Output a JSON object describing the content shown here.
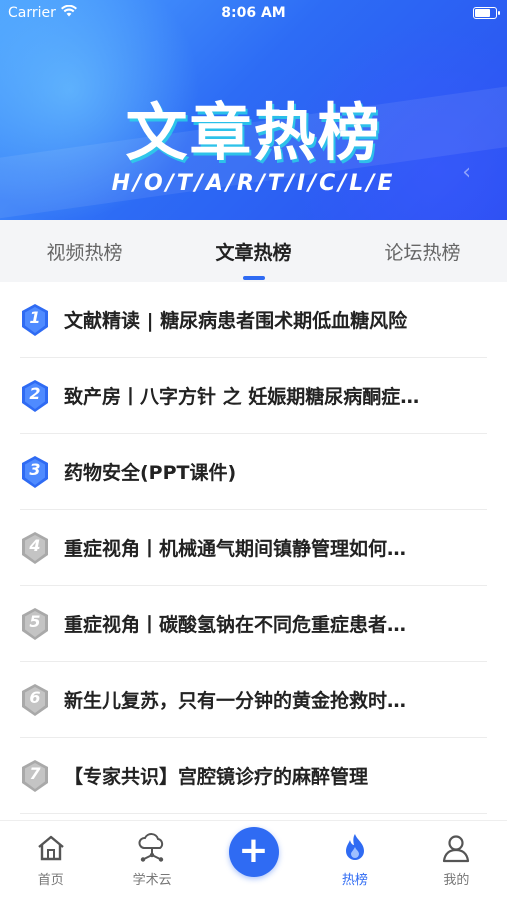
{
  "status": {
    "carrier": "Carrier",
    "time": "8:06 AM",
    "battery": 0.85
  },
  "hero": {
    "title": "文章热榜",
    "subtitle": "H/O/T/A/R/T/I/C/L/E"
  },
  "tabs": [
    {
      "label": "视频热榜",
      "active": false
    },
    {
      "label": "文章热榜",
      "active": true
    },
    {
      "label": "论坛热榜",
      "active": false
    }
  ],
  "articles": [
    {
      "rank": "1",
      "title": "文献精读 | 糖尿病患者围术期低血糖风险",
      "tier": "top"
    },
    {
      "rank": "2",
      "title": "致产房丨八字方针 之 妊娠期糖尿病酮症…",
      "tier": "top"
    },
    {
      "rank": "3",
      "title": "药物安全(PPT课件)",
      "tier": "top"
    },
    {
      "rank": "4",
      "title": "重症视角丨机械通气期间镇静管理如何…",
      "tier": "normal"
    },
    {
      "rank": "5",
      "title": "重症视角丨碳酸氢钠在不同危重症患者…",
      "tier": "normal"
    },
    {
      "rank": "6",
      "title": "新生儿复苏，只有一分钟的黄金抢救时…",
      "tier": "normal"
    },
    {
      "rank": "7",
      "title": "【专家共识】宫腔镜诊疗的麻醉管理",
      "tier": "normal"
    }
  ],
  "tabbar": [
    {
      "label": "首页",
      "icon": "home-icon"
    },
    {
      "label": "学术云",
      "icon": "cloud-network-icon"
    },
    {
      "label": "",
      "icon": "plus-icon"
    },
    {
      "label": "热榜",
      "icon": "flame-icon",
      "active": true
    },
    {
      "label": "我的",
      "icon": "user-icon"
    }
  ],
  "colors": {
    "accent": "#2f6bf3",
    "top_badge": "#2f6bf3",
    "normal_badge": "#b8b8b8"
  }
}
